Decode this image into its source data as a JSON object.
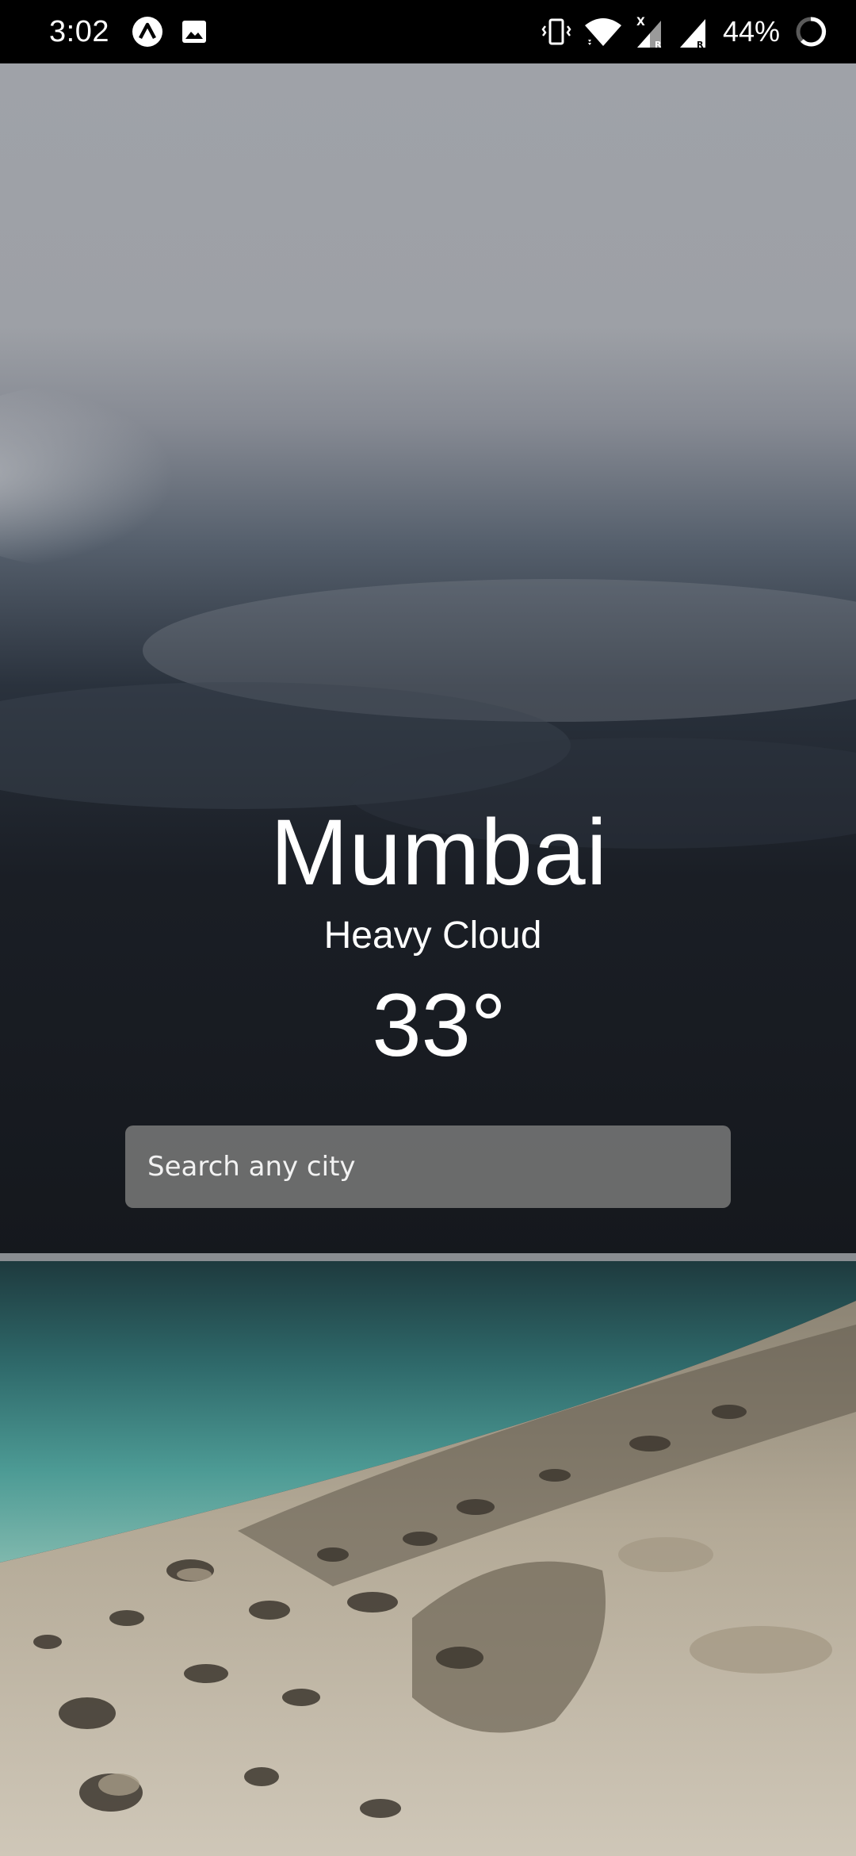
{
  "status_bar": {
    "time": "3:02",
    "battery_percent": "44%",
    "icons": [
      "app-notification-icon",
      "image-notification-icon",
      "vibrate-icon",
      "wifi-icon",
      "signal-x-icon",
      "signal-icon",
      "battery-icon"
    ]
  },
  "weather": {
    "city": "Mumbai",
    "condition": "Heavy Cloud",
    "temperature": "33°"
  },
  "search": {
    "placeholder": "Search any city",
    "value": ""
  },
  "colors": {
    "text": "#ffffff",
    "status_bar_bg": "#000000",
    "search_bg": "#767676"
  }
}
